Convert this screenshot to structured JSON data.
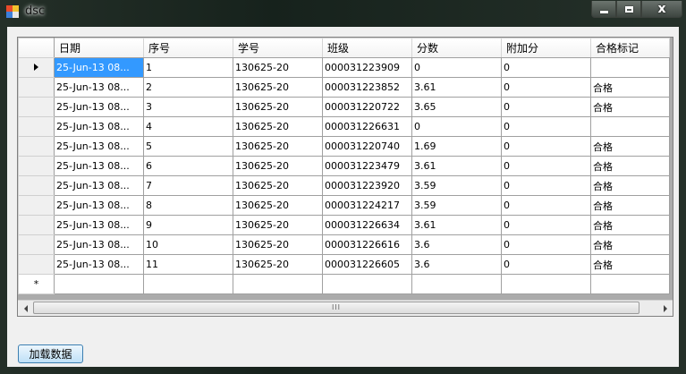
{
  "window": {
    "title": "dsc",
    "close_glyph": "x"
  },
  "grid": {
    "columns": [
      "日期",
      "序号",
      "学号",
      "班级",
      "分数",
      "附加分",
      "合格标记"
    ],
    "rows": [
      [
        "25-Jun-13 08...",
        "1",
        "130625-20",
        "000031223909",
        "0",
        "0",
        ""
      ],
      [
        "25-Jun-13 08...",
        "2",
        "130625-20",
        "000031223852",
        "3.61",
        "0",
        "合格"
      ],
      [
        "25-Jun-13 08...",
        "3",
        "130625-20",
        "000031220722",
        "3.65",
        "0",
        "合格"
      ],
      [
        "25-Jun-13 08...",
        "4",
        "130625-20",
        "000031226631",
        "0",
        "0",
        ""
      ],
      [
        "25-Jun-13 08...",
        "5",
        "130625-20",
        "000031220740",
        "1.69",
        "0",
        "合格"
      ],
      [
        "25-Jun-13 08...",
        "6",
        "130625-20",
        "000031223479",
        "3.61",
        "0",
        "合格"
      ],
      [
        "25-Jun-13 08...",
        "7",
        "130625-20",
        "000031223920",
        "3.59",
        "0",
        "合格"
      ],
      [
        "25-Jun-13 08...",
        "8",
        "130625-20",
        "000031224217",
        "3.59",
        "0",
        "合格"
      ],
      [
        "25-Jun-13 08...",
        "9",
        "130625-20",
        "000031226634",
        "3.61",
        "0",
        "合格"
      ],
      [
        "25-Jun-13 08...",
        "10",
        "130625-20",
        "000031226616",
        "3.6",
        "0",
        "合格"
      ],
      [
        "25-Jun-13 08...",
        "11",
        "130625-20",
        "000031226605",
        "3.6",
        "0",
        "合格"
      ]
    ],
    "new_row_marker": "*",
    "scroll_grip": "III"
  },
  "buttons": {
    "load_data": "加载数据"
  },
  "icons": {
    "app": "app-icon",
    "current_row": "row-arrow-icon",
    "new_row": "new-row-icon",
    "scroll_left": "chevron-left-icon",
    "scroll_right": "chevron-right-icon"
  },
  "colors": {
    "selection": "#3399ff",
    "button_border": "#3c7fb1"
  }
}
